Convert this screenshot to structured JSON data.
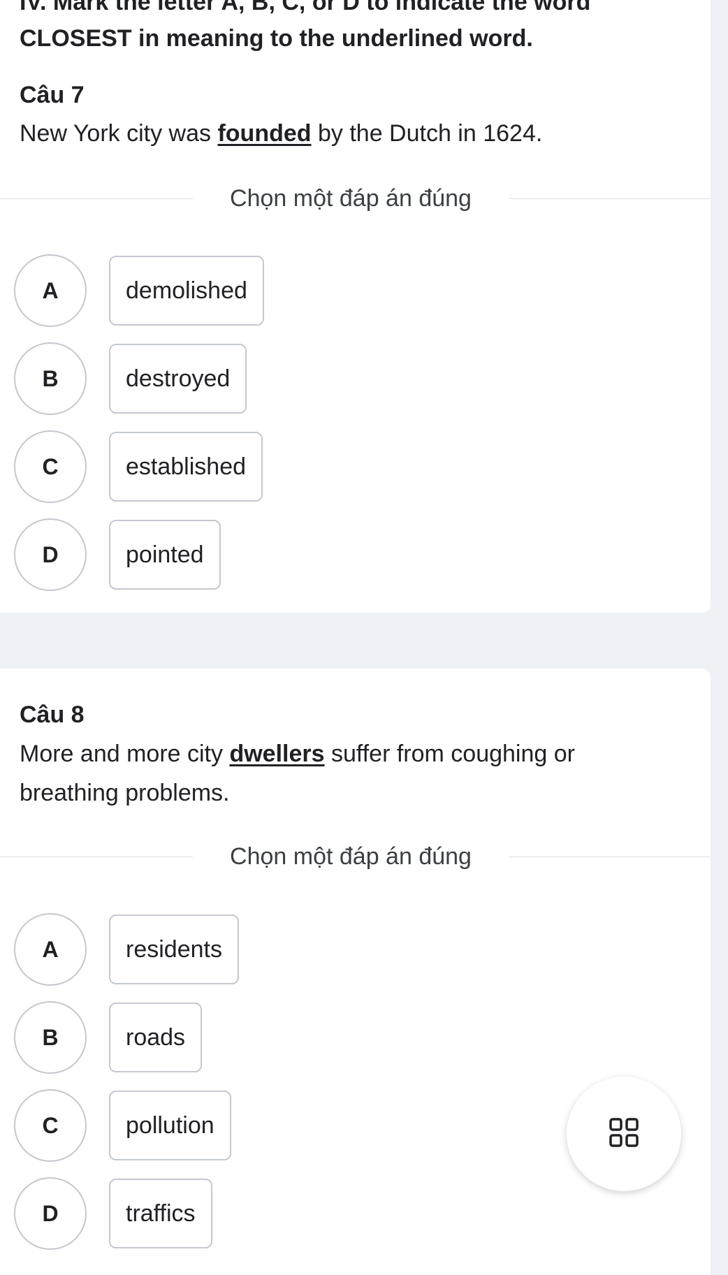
{
  "instruction": {
    "line1": "IV. Mark the letter A, B, C, or D to indicate the word",
    "line2": "CLOSEST in meaning to the underlined word."
  },
  "questions": [
    {
      "title": "Câu 7",
      "text_before": "New York city was ",
      "underlined": "founded",
      "text_after": " by the Dutch in 1624.",
      "prompt": "Chọn một đáp án đúng",
      "options": [
        {
          "letter": "A",
          "text": "demolished"
        },
        {
          "letter": "B",
          "text": "destroyed"
        },
        {
          "letter": "C",
          "text": "established"
        },
        {
          "letter": "D",
          "text": "pointed"
        }
      ]
    },
    {
      "title": "Câu 8",
      "text_before": "More and more city ",
      "underlined": "dwellers",
      "text_after": " suffer from coughing or breathing problems.",
      "prompt": "Chọn một đáp án đúng",
      "options": [
        {
          "letter": "A",
          "text": "residents"
        },
        {
          "letter": "B",
          "text": "roads"
        },
        {
          "letter": "C",
          "text": "pollution"
        },
        {
          "letter": "D",
          "text": "traffics"
        }
      ]
    }
  ],
  "fab": {
    "icon": "grid-icon"
  },
  "colors": {
    "page_background": "#eef1f5",
    "card_background": "#ffffff",
    "border": "#c4c8cf",
    "text": "#202124"
  }
}
